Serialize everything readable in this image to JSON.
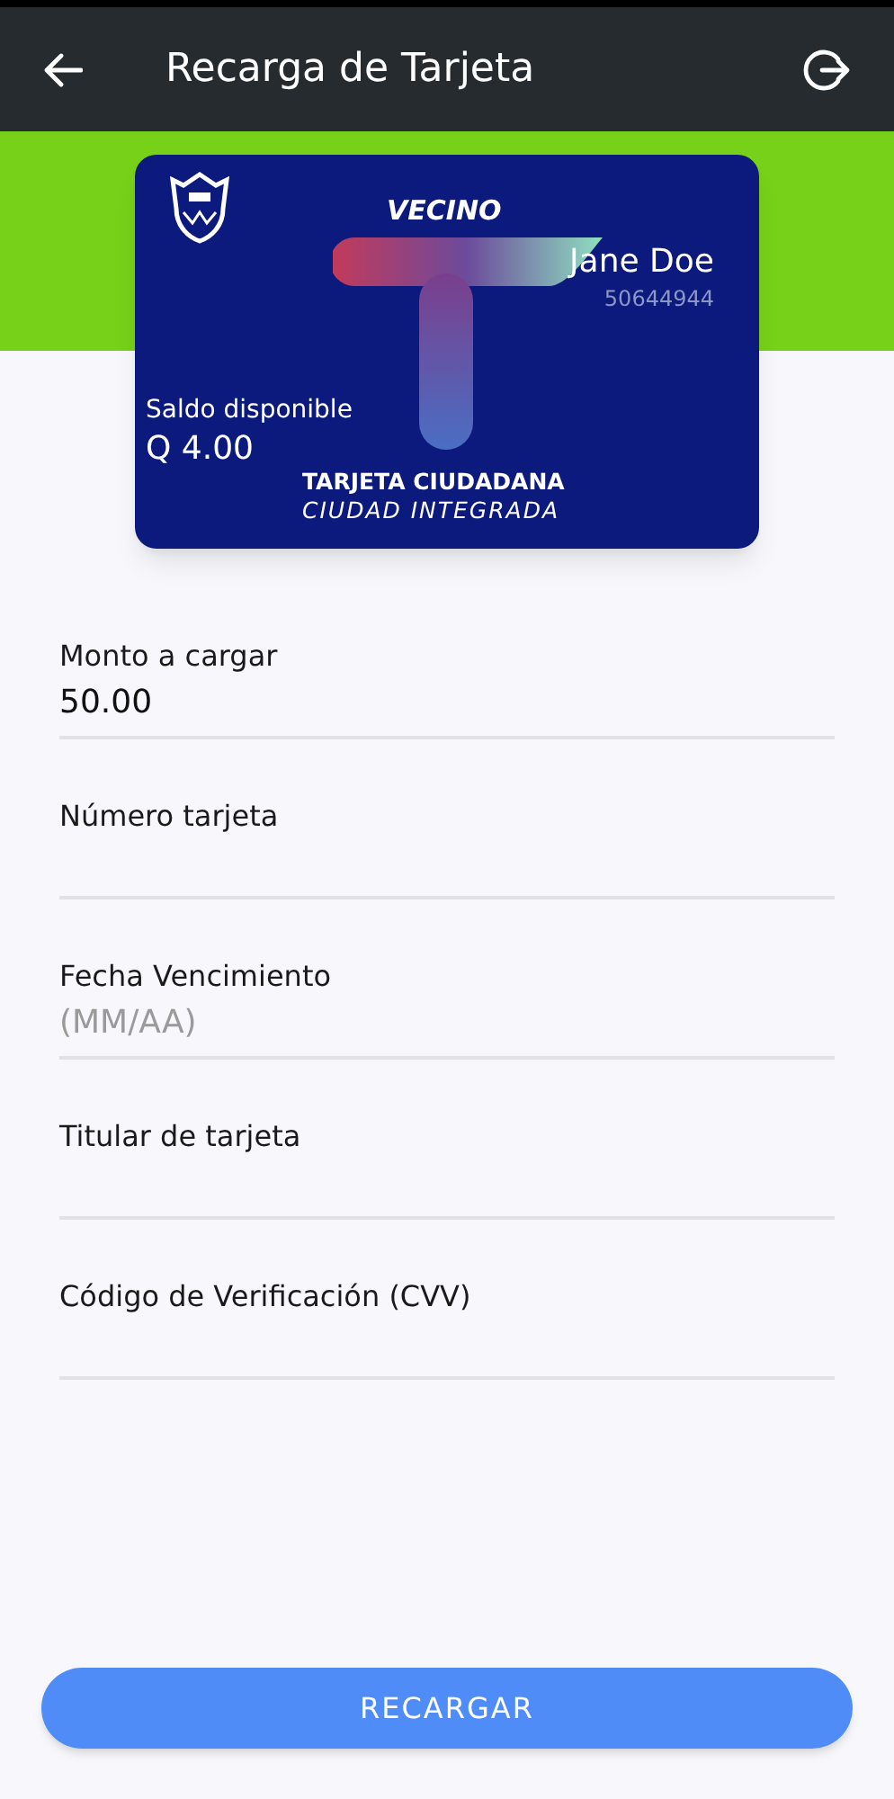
{
  "header": {
    "title": "Recarga de Tarjeta"
  },
  "card": {
    "type_label": "VECINO",
    "holder": "Jane Doe",
    "number": "50644944",
    "balance_label": "Saldo disponible",
    "balance": "Q 4.00",
    "brand_line_1": "TARJETA CIUDADANA",
    "brand_line_2": "CIUDAD INTEGRADA"
  },
  "fields": [
    {
      "label": "Monto a cargar",
      "value": "50.00"
    },
    {
      "label": "Número tarjeta"
    },
    {
      "label": "Fecha Vencimiento",
      "placeholder": "(MM/AA)"
    },
    {
      "label": "Titular de tarjeta"
    },
    {
      "label": "Código de Verificación (CVV)"
    }
  ],
  "button": {
    "label": "RECARGAR"
  }
}
